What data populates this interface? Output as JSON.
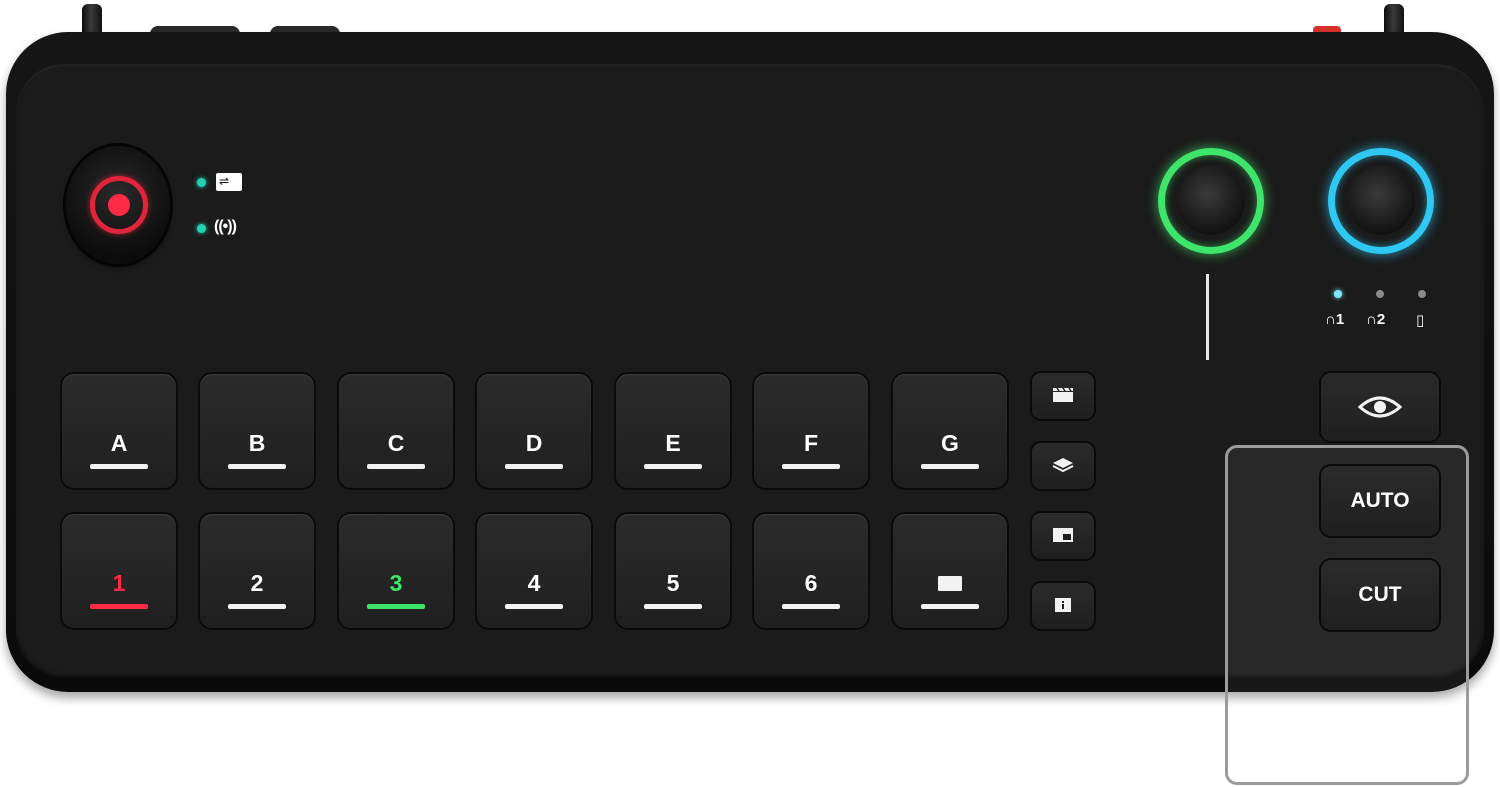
{
  "device": {
    "status": {
      "usb_icon": "usb-icon",
      "wireless_label": "((•))"
    },
    "record_button": {
      "icon": "record-icon",
      "color": "#ff2a45"
    },
    "knobs": [
      {
        "icon": "volume-knob-icon",
        "ring_color": "#3fe46a"
      },
      {
        "icon": "monitor-knob-icon",
        "ring_color": "#2fc8f2"
      }
    ],
    "outputs": [
      {
        "label": "∩1",
        "icon": "headphones-icon",
        "active": true
      },
      {
        "label": "∩2",
        "icon": "headphones-icon",
        "active": false
      },
      {
        "label": "▯",
        "icon": "speaker-icon",
        "active": false
      }
    ],
    "preview_row": {
      "keys": [
        "A",
        "B",
        "C",
        "D",
        "E",
        "F",
        "G"
      ]
    },
    "program_row": {
      "keys": [
        "1",
        "2",
        "3",
        "4",
        "5",
        "6",
        ""
      ],
      "active_program": "1",
      "active_preview": "3",
      "last_key_icon": "fullscreen-icon"
    },
    "side_keys": [
      "scene-clapper-icon",
      "layers-icon",
      "picture-in-picture-icon",
      "info-icon"
    ],
    "preview_button": {
      "icon": "eye-icon"
    },
    "transition": {
      "auto_label": "AUTO",
      "cut_label": "CUT"
    },
    "colors": {
      "program": "#ff2a45",
      "preview": "#3fe46a",
      "status_led": "#22d1b0"
    }
  }
}
